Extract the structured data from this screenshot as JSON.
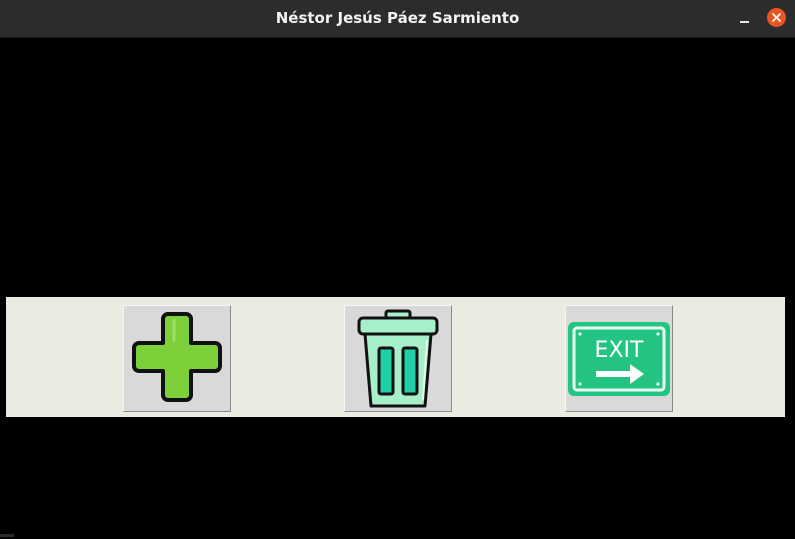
{
  "window": {
    "title": "Néstor Jesús Páez Sarmiento",
    "controls": {
      "minimize_icon": "minimize-icon",
      "close_icon": "close-icon"
    }
  },
  "toolbar": {
    "buttons": [
      {
        "id": "add",
        "icon": "plus-icon",
        "color": "#7ed03a"
      },
      {
        "id": "delete",
        "icon": "trash-icon",
        "color": "#1fd0a6"
      },
      {
        "id": "exit",
        "icon": "exit-sign-icon",
        "color": "#23c482",
        "sign_text": "EXIT"
      }
    ]
  },
  "colors": {
    "titlebar": "#2c2c2c",
    "close_button": "#e95420",
    "toolbar_background": "#ecebe2",
    "button_face": "#d9d9d9",
    "canvas": "#000000"
  }
}
